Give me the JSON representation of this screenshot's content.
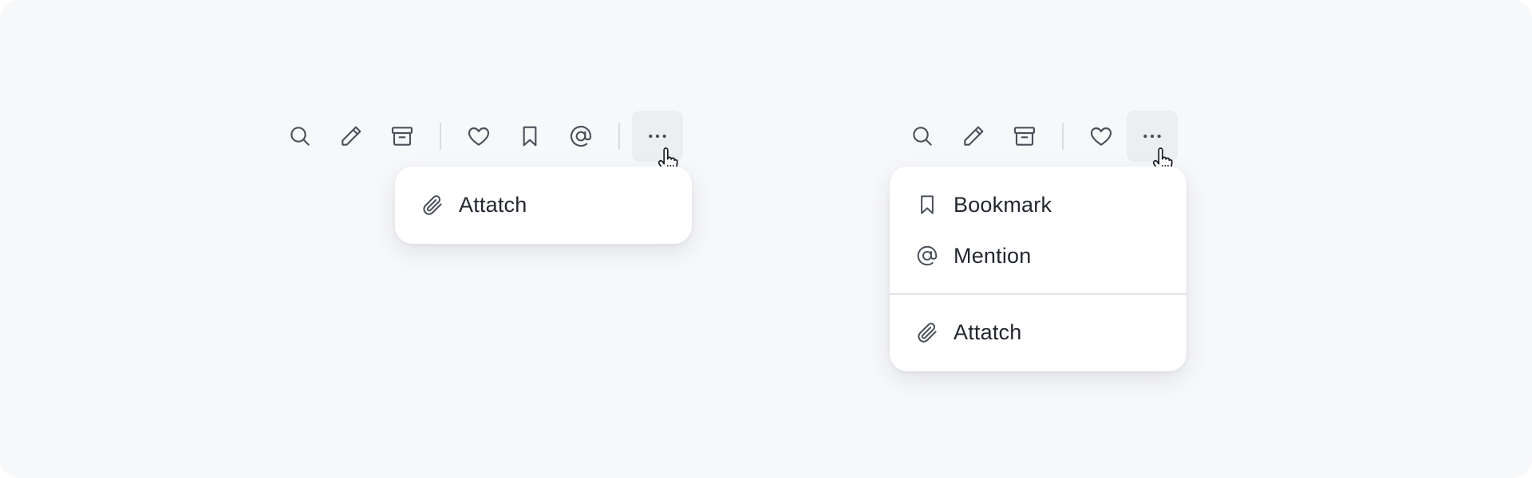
{
  "colors": {
    "background": "#f7f8fa",
    "icon": "#4b5059",
    "text": "#23272f",
    "active": "#eceef2"
  },
  "left": {
    "toolbar": [
      {
        "icon": "search-icon"
      },
      {
        "icon": "pencil-icon"
      },
      {
        "icon": "archive-icon"
      },
      {
        "icon": "heart-icon"
      },
      {
        "icon": "bookmark-icon"
      },
      {
        "icon": "at-sign-icon"
      },
      {
        "icon": "more-horizontal-icon",
        "active": true
      }
    ],
    "menu": {
      "items": [
        {
          "icon": "paperclip-icon",
          "label": "Attatch"
        }
      ]
    }
  },
  "right": {
    "toolbar": [
      {
        "icon": "search-icon"
      },
      {
        "icon": "pencil-icon"
      },
      {
        "icon": "archive-icon"
      },
      {
        "icon": "heart-icon"
      },
      {
        "icon": "more-horizontal-icon",
        "active": true
      }
    ],
    "menu": {
      "items": [
        {
          "icon": "bookmark-icon",
          "label": "Bookmark"
        },
        {
          "icon": "at-sign-icon",
          "label": "Mention"
        },
        {
          "icon": "paperclip-icon",
          "label": "Attatch"
        }
      ]
    }
  }
}
